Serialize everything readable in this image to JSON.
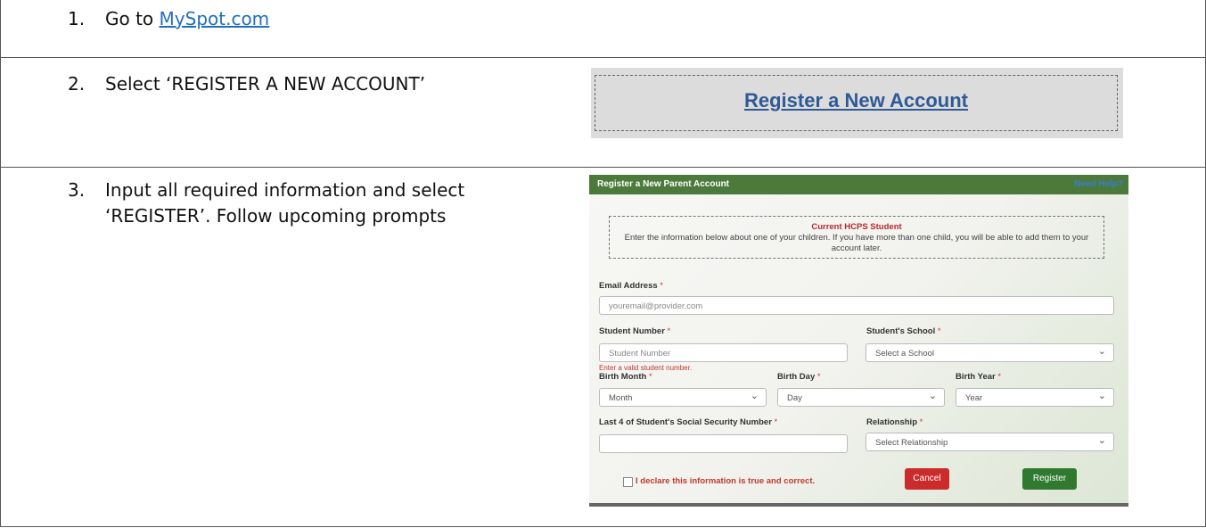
{
  "steps": [
    {
      "number": "1.",
      "text": "Go to ",
      "link": "MySpot.com"
    },
    {
      "number": "2.",
      "text": "Select ‘REGISTER A NEW ACCOUNT’"
    },
    {
      "number": "3.",
      "text": "Input all required information and select ‘REGISTER’. Follow upcoming prompts"
    }
  ],
  "banner": {
    "link_label": "Register a New Account"
  },
  "form": {
    "title": "Register a New Parent Account",
    "help": "Need Help?",
    "notice_title": "Current HCPS Student",
    "notice_text": "Enter the information below about one of your children. If you have more than one child, you will be able to add them to your account later.",
    "email_label": "Email Address",
    "email_placeholder": "youremail@provider.com",
    "student_number_label": "Student Number",
    "student_number_placeholder": "Student Number",
    "student_number_error": "Enter a valid student number.",
    "school_label": "Student's School",
    "school_value": "Select a School",
    "birth_month_label": "Birth Month",
    "birth_month_value": "Month",
    "birth_day_label": "Birth Day",
    "birth_day_value": "Day",
    "birth_year_label": "Birth Year",
    "birth_year_value": "Year",
    "ssn_label": "Last 4 of Student's Social Security Number",
    "relationship_label": "Relationship",
    "relationship_value": "Select Relationship",
    "required_mark": "*",
    "declaration": "I declare this information is true and correct.",
    "cancel_label": "Cancel",
    "register_label": "Register"
  },
  "colors": {
    "header_green": "#4c7a3b",
    "cancel_red": "#cc2b2b",
    "register_green": "#2f7a2f",
    "link_blue": "#1f6fc0"
  }
}
